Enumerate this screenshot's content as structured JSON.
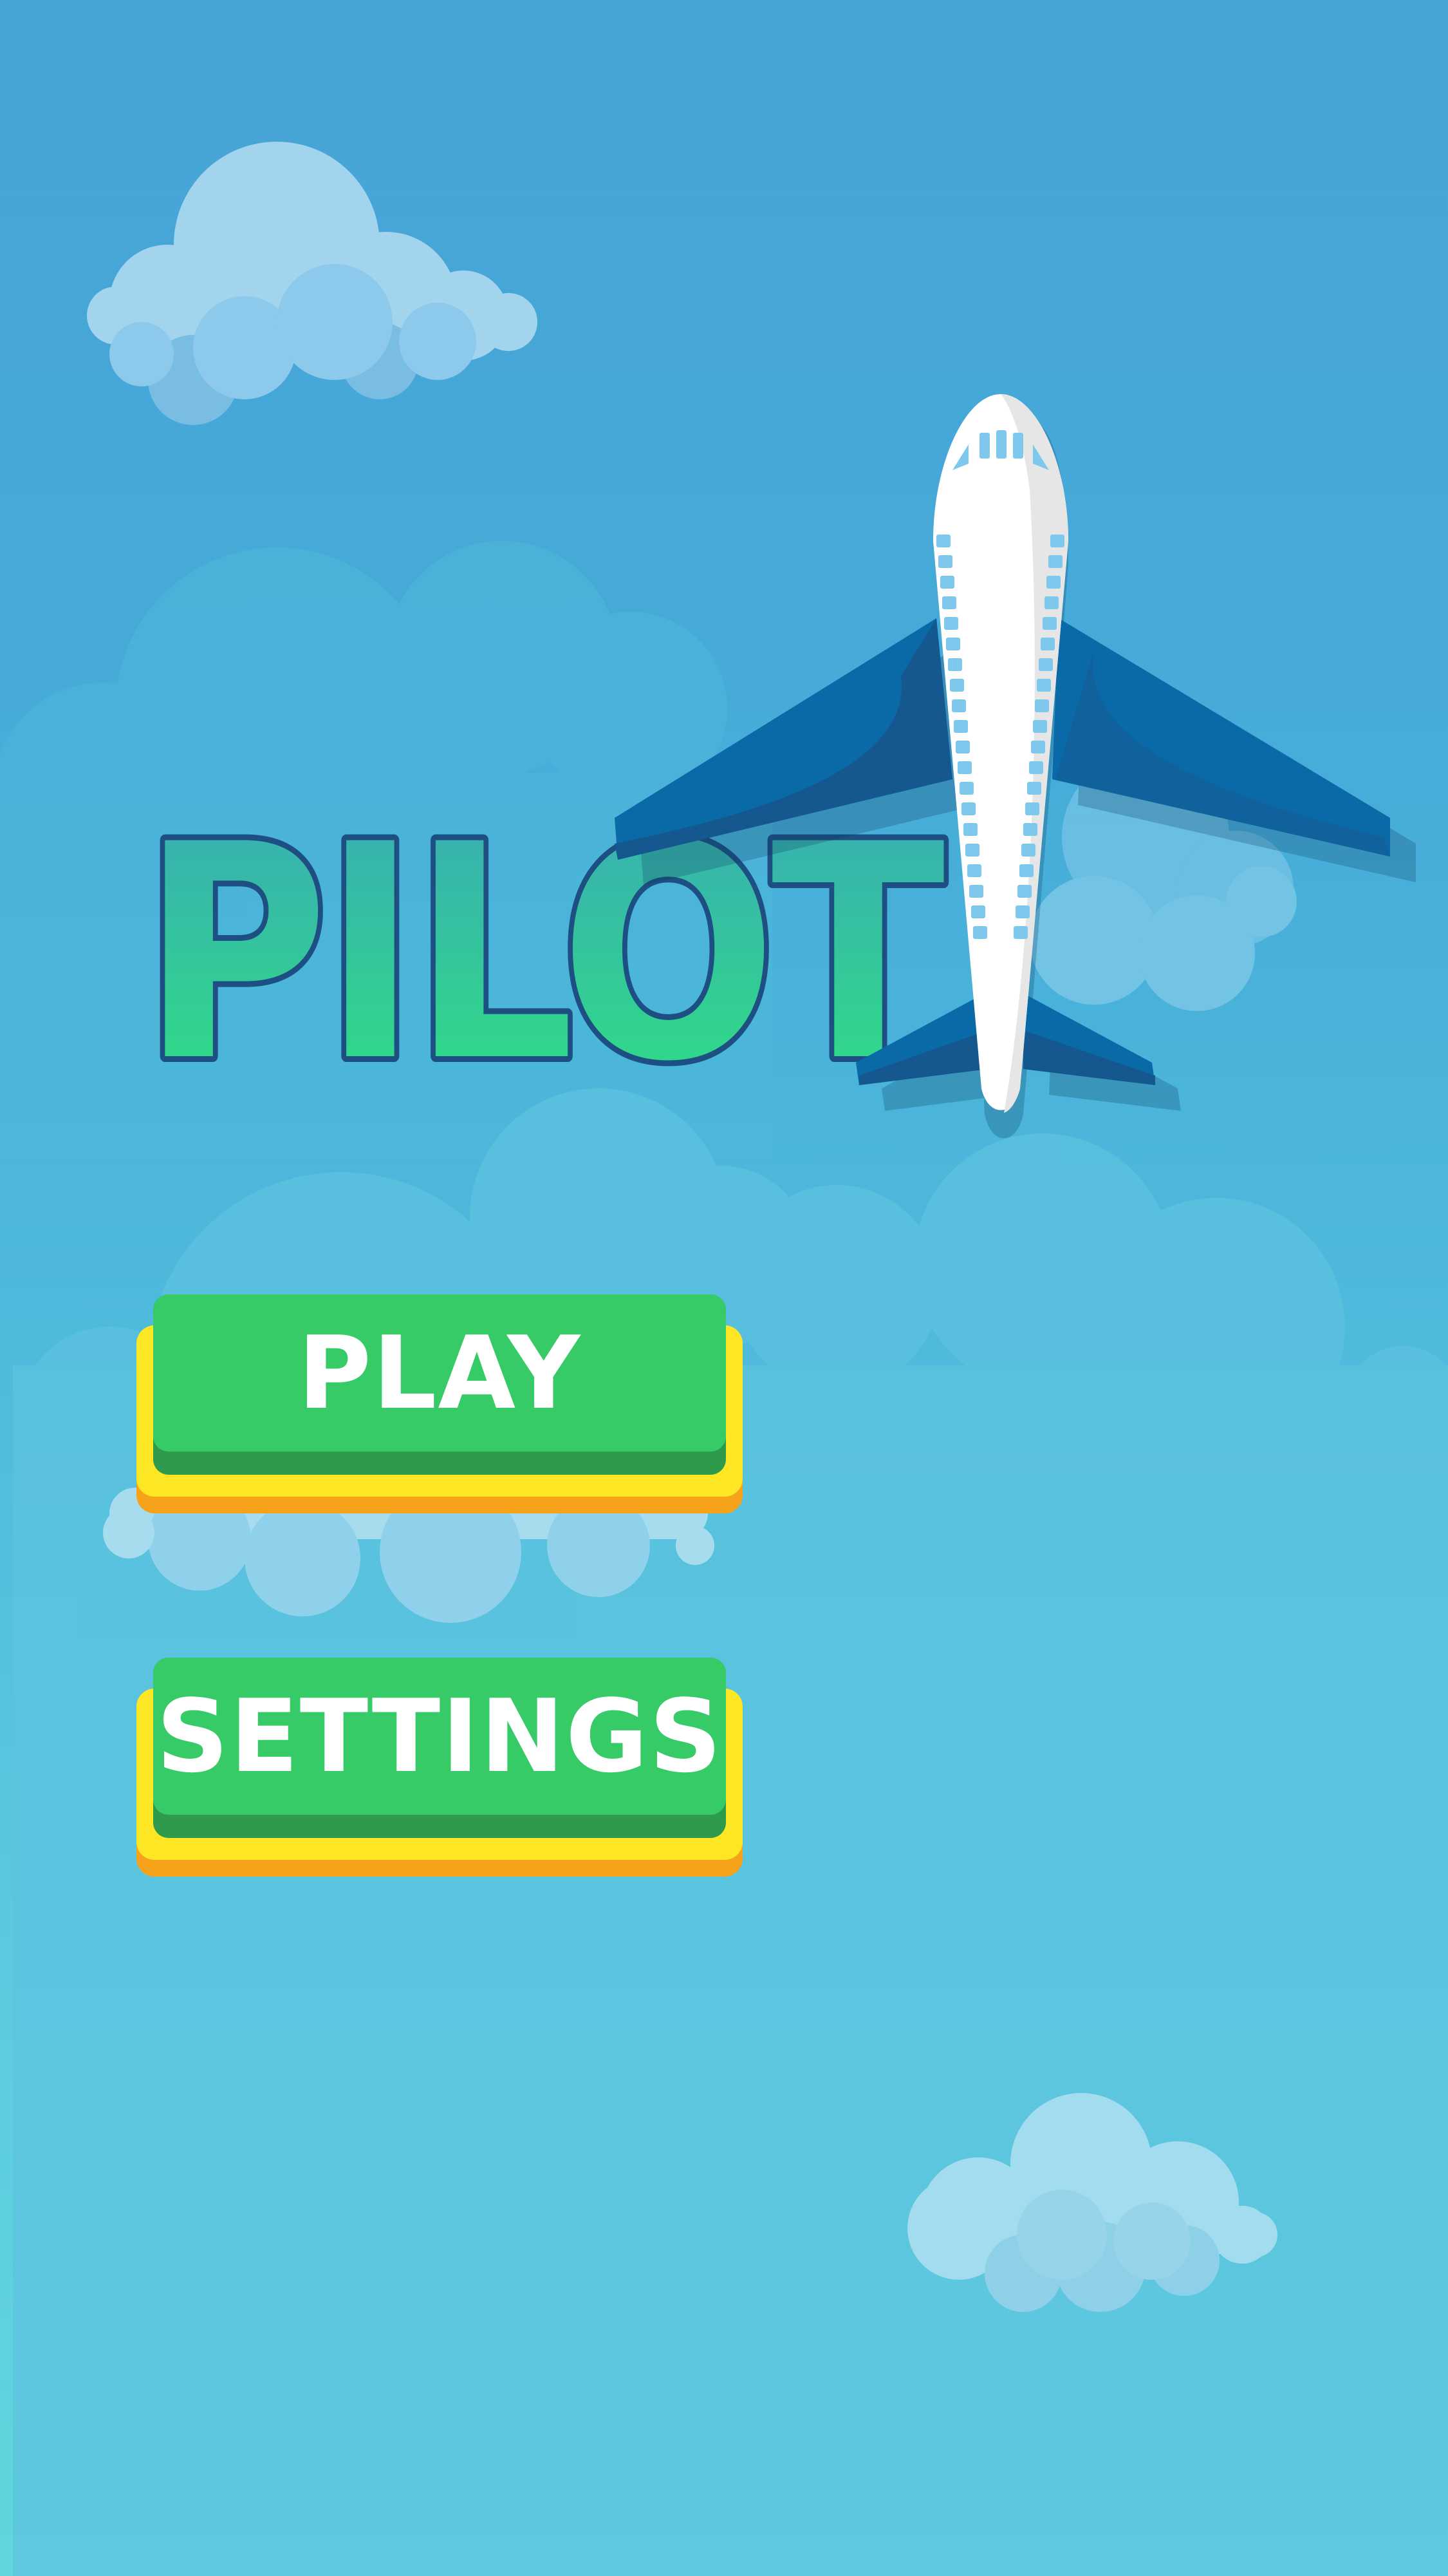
{
  "game": {
    "title": "PILOT"
  },
  "menu": {
    "play_label": "PLAY",
    "settings_label": "SETTINGS"
  },
  "colors": {
    "sky_top": "#47a3d6",
    "sky_bottom": "#5fd6dc",
    "title_fill_top": "#3aa9b8",
    "title_fill_bottom": "#2ee27f",
    "title_outline": "#1d4f82",
    "button_face": "#37cb67",
    "button_shade": "#2f9a4c",
    "button_rim": "#fde624",
    "button_base": "#f7a21b",
    "plane_body": "#ffffff",
    "plane_wing": "#0a6aa8",
    "plane_window": "#7ec8ee"
  },
  "icons": {
    "plane": "airplane-icon",
    "clouds": "cloud-icon"
  }
}
